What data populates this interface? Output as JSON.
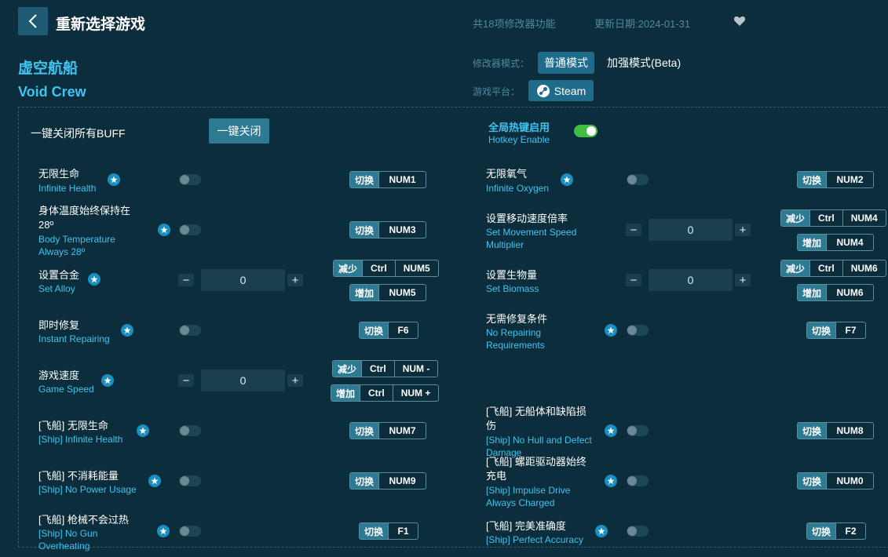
{
  "header": {
    "title": "重新选择游戏",
    "feature_count": "共18项修改器功能",
    "update_date": "更新日期:2024-01-31"
  },
  "game": {
    "name_cn": "虚空航船",
    "name_en": "Void Crew"
  },
  "mode": {
    "label": "修改器模式：",
    "normal": "普通模式",
    "enhanced": "加强模式(Beta)"
  },
  "platform": {
    "label": "游戏平台：",
    "name": "Steam"
  },
  "buff": {
    "label": "一键关闭所有BUFF",
    "button": "一键关闭"
  },
  "hotkey": {
    "label_cn": "全局热键启用",
    "label_en": "Hotkey Enable",
    "enabled": true
  },
  "actions": {
    "toggle": "切换",
    "decrease": "减少",
    "increase": "增加"
  },
  "features": {
    "f1": {
      "cn": "无限生命",
      "en": "Infinite Health",
      "key": "NUM1"
    },
    "f2": {
      "cn": "无限氧气",
      "en": "Infinite Oxygen",
      "key": "NUM2"
    },
    "f3": {
      "cn1": "身体温度始终保持在",
      "cn2": "28º",
      "en1": "Body Temperature",
      "en2": "Always 28º",
      "key": "NUM3"
    },
    "f4": {
      "cn": "设置移动速度倍率",
      "en1": "Set Movement Speed",
      "en2": "Multiplier",
      "value": "0",
      "dec_mod": "Ctrl",
      "dec_key": "NUM4",
      "inc_key": "NUM4"
    },
    "f5": {
      "cn": "设置合金",
      "en": "Set Alloy",
      "value": "0",
      "dec_mod": "Ctrl",
      "dec_key": "NUM5",
      "inc_key": "NUM5"
    },
    "f6": {
      "cn": "设置生物量",
      "en": "Set Biomass",
      "value": "0",
      "dec_mod": "Ctrl",
      "dec_key": "NUM6",
      "inc_key": "NUM6"
    },
    "f7": {
      "cn": "即时修复",
      "en": "Instant Repairing",
      "key": "F6"
    },
    "f8": {
      "cn": "无需修复条件",
      "en1": "No Repairing",
      "en2": "Requirements",
      "key": "F7"
    },
    "f9": {
      "cn": "游戏速度",
      "en": "Game Speed",
      "value": "0",
      "dec_mod": "Ctrl",
      "dec_key": "NUM -",
      "inc_mod": "Ctrl",
      "inc_key": "NUM +"
    },
    "f10": {
      "cn": "[飞船] 无限生命",
      "en": "[Ship] Infinite Health",
      "key": "NUM7"
    },
    "f11": {
      "cn1": "[飞船] 无船体和缺陷损",
      "cn2": "伤",
      "en1": "[Ship] No Hull and Defect",
      "en2": "Damage",
      "key": "NUM8"
    },
    "f12": {
      "cn": "[飞船] 不消耗能量",
      "en": "[Ship] No Power Usage",
      "key": "NUM9"
    },
    "f13": {
      "cn1": "[飞船] 螺距驱动器始终",
      "cn2": "充电",
      "en1": "[Ship] Impulse Drive",
      "en2": "Always Charged",
      "key": "NUM0"
    },
    "f14": {
      "cn": "[飞船] 枪械不会过热",
      "en1": "[Ship] No Gun",
      "en2": "Overheating",
      "key": "F1"
    },
    "f15": {
      "cn": "[飞船] 完美准确度",
      "en": "[Ship] Perfect Accuracy",
      "key": "F2"
    }
  }
}
